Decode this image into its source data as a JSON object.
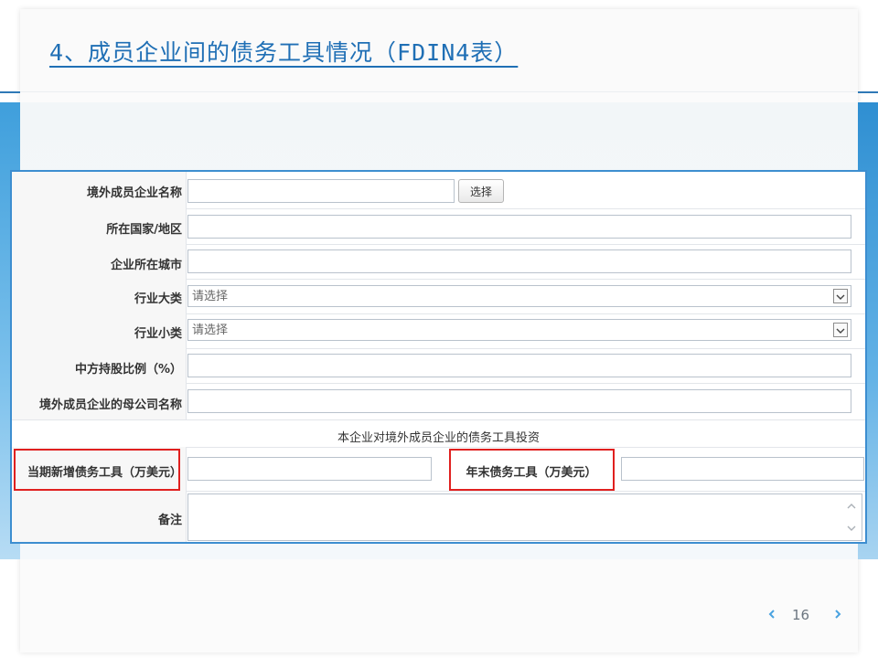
{
  "slide": {
    "title": "4、成员企业间的债务工具情况（FDIN4表）",
    "page_number": "16"
  },
  "form": {
    "rows": [
      {
        "label": "境外成员企业名称",
        "value": "",
        "button": "选择"
      },
      {
        "label": "所在国家/地区",
        "value": ""
      },
      {
        "label": "企业所在城市",
        "value": ""
      },
      {
        "label": "行业大类",
        "select_value": "请选择"
      },
      {
        "label": "行业小类",
        "select_value": "请选择"
      },
      {
        "label": "中方持股比例（%）",
        "value": ""
      },
      {
        "label": "境外成员企业的母公司名称",
        "value": ""
      }
    ],
    "section_caption": "本企业对境外成员企业的债务工具投资",
    "new_debt_label": "当期新增债务工具（万美元）",
    "year_end_label": "年末债务工具（万美元）",
    "remark_label": "备注"
  },
  "colors": {
    "title": "#1f6fb5",
    "panel_border": "#3d8ed0",
    "highlight": "#e0201f",
    "pager": "#4aa3e0"
  }
}
